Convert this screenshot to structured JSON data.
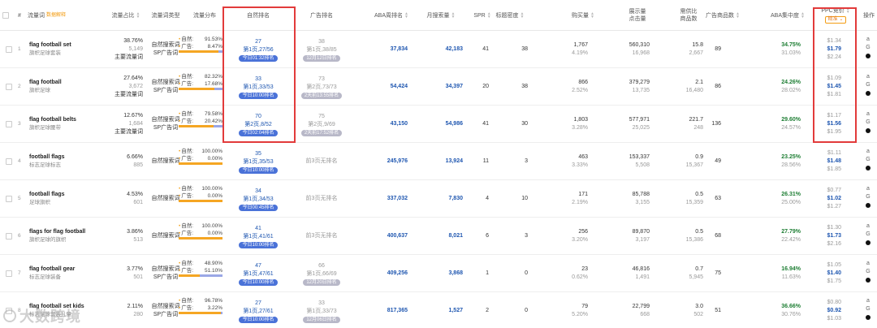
{
  "headers": {
    "idx": "#",
    "keyword": "流量词",
    "keyword_tag": "数据解释",
    "traffic_share": "流量占比",
    "traffic_type": "流量词类型",
    "traffic_dist": "流量分布",
    "organic_rank": "自然排名",
    "ad_rank": "广告排名",
    "aba_rank": "ABA周排名",
    "monthly_search": "月搜索量",
    "spr": "SPR",
    "title_density": "标题密度",
    "purchases": "购买量",
    "impressions": "展示量\n点击量",
    "supply_demand": "需供比\n商品数",
    "ad_products": "广告商品数",
    "aba_concentration": "ABA集中度",
    "ppc": "PPC竞价",
    "ppc_filter": "精准",
    "ops": "操作"
  },
  "rows": [
    {
      "idx": "1",
      "kw": "flag football set",
      "kw_cn": "旗帜足球套装",
      "share": "38.76%",
      "share_n": "5,149",
      "share_tag": "主要流量词",
      "type1": "自然搜索词",
      "type2": "SP广告词",
      "nat_label": "自然:",
      "nat": "91.53%",
      "ad_label": "广告:",
      "ad": "8.47%",
      "nat_frac": 0.9153,
      "org_num": "27",
      "org_page": "第1页,27/56",
      "org_badge": "今日01:32排名",
      "org_grey": false,
      "ad_num": "38",
      "ad_page": "第1页,38/85",
      "ad_badge": "12月12日排名",
      "ad_none": "",
      "aba": "37,834",
      "monthly": "42,183",
      "spr": "41",
      "density": "38",
      "buy": "1,767",
      "buy_pct": "4.19%",
      "imp": "560,310",
      "clk": "16,968",
      "sd": "15.8",
      "prod": "2,667",
      "adp": "89",
      "conc": "34.75%",
      "conc2": "31.03%",
      "ppc1": "$1.34",
      "ppc2": "$1.79",
      "ppc3": "$2.24"
    },
    {
      "idx": "2",
      "kw": "flag football",
      "kw_cn": "旗帜足球",
      "share": "27.64%",
      "share_n": "3,672",
      "share_tag": "主要流量词",
      "type1": "自然搜索词",
      "type2": "SP广告词",
      "nat_label": "自然:",
      "nat": "82.32%",
      "ad_label": "广告:",
      "ad": "17.68%",
      "nat_frac": 0.8232,
      "org_num": "33",
      "org_page": "第1页,33/53",
      "org_badge": "今日10:00排名",
      "org_grey": false,
      "ad_num": "73",
      "ad_page": "第2页,73/73",
      "ad_badge": "2天前13:55排名",
      "ad_none": "",
      "aba": "54,424",
      "monthly": "34,397",
      "spr": "20",
      "density": "38",
      "buy": "866",
      "buy_pct": "2.52%",
      "imp": "379,279",
      "clk": "13,735",
      "sd": "2.1",
      "prod": "16,480",
      "adp": "86",
      "conc": "24.26%",
      "conc2": "28.02%",
      "ppc1": "$1.09",
      "ppc2": "$1.45",
      "ppc3": "$1.81"
    },
    {
      "idx": "3",
      "kw": "flag football belts",
      "kw_cn": "旗帜足球腰带",
      "share": "12.67%",
      "share_n": "1,684",
      "share_tag": "主要流量词",
      "type1": "自然搜索词",
      "type2": "SP广告词",
      "nat_label": "自然:",
      "nat": "79.58%",
      "ad_label": "广告:",
      "ad": "20.42%",
      "nat_frac": 0.7958,
      "org_num": "70",
      "org_page": "第2页,8/52",
      "org_badge": "今日02:04排名",
      "org_grey": false,
      "ad_num": "75",
      "ad_page": "第2页,9/69",
      "ad_badge": "2天前17:52排名",
      "ad_none": "",
      "aba": "43,150",
      "monthly": "54,986",
      "spr": "41",
      "density": "30",
      "buy": "1,803",
      "buy_pct": "3.28%",
      "imp": "577,971",
      "clk": "25,025",
      "sd": "221.7",
      "prod": "248",
      "adp": "136",
      "conc": "29.60%",
      "conc2": "24.57%",
      "ppc1": "$1.17",
      "ppc2": "$1.56",
      "ppc3": "$1.95"
    },
    {
      "idx": "4",
      "kw": "football flags",
      "kw_cn": "标志足球标志",
      "share": "6.66%",
      "share_n": "885",
      "share_tag": "",
      "type1": "自然搜索词",
      "type2": "",
      "nat_label": "自然:",
      "nat": "100.00%",
      "ad_label": "广告:",
      "ad": "0.00%",
      "nat_frac": 1.0,
      "org_num": "35",
      "org_page": "第1页,35/53",
      "org_badge": "今日10:00排名",
      "org_grey": false,
      "ad_num": "",
      "ad_page": "",
      "ad_badge": "",
      "ad_none": "前3页无排名",
      "aba": "245,976",
      "monthly": "13,924",
      "spr": "11",
      "density": "3",
      "buy": "463",
      "buy_pct": "3.33%",
      "imp": "153,337",
      "clk": "5,508",
      "sd": "0.9",
      "prod": "15,367",
      "adp": "49",
      "conc": "23.25%",
      "conc2": "28.56%",
      "ppc1": "$1.11",
      "ppc2": "$1.48",
      "ppc3": "$1.85"
    },
    {
      "idx": "5",
      "kw": "football flags",
      "kw_cn": "足球旗帜",
      "share": "4.53%",
      "share_n": "601",
      "share_tag": "",
      "type1": "自然搜索词",
      "type2": "",
      "nat_label": "自然:",
      "nat": "100.00%",
      "ad_label": "广告:",
      "ad": "0.00%",
      "nat_frac": 1.0,
      "org_num": "34",
      "org_page": "第1页,34/53",
      "org_badge": "今日00:45排名",
      "org_grey": false,
      "ad_num": "",
      "ad_page": "",
      "ad_badge": "",
      "ad_none": "前3页无排名",
      "aba": "337,032",
      "monthly": "7,830",
      "spr": "4",
      "density": "10",
      "buy": "171",
      "buy_pct": "2.19%",
      "imp": "85,788",
      "clk": "3,155",
      "sd": "0.5",
      "prod": "15,359",
      "adp": "63",
      "conc": "26.31%",
      "conc2": "25.00%",
      "ppc1": "$0.77",
      "ppc2": "$1.02",
      "ppc3": "$1.27"
    },
    {
      "idx": "6",
      "kw": "flags for flag football",
      "kw_cn": "旗帜足球的旗帜",
      "share": "3.86%",
      "share_n": "513",
      "share_tag": "",
      "type1": "自然搜索词",
      "type2": "",
      "nat_label": "自然:",
      "nat": "100.00%",
      "ad_label": "广告:",
      "ad": "0.00%",
      "nat_frac": 1.0,
      "org_num": "41",
      "org_page": "第1页,41/61",
      "org_badge": "今日10:00排名",
      "org_grey": false,
      "ad_num": "",
      "ad_page": "",
      "ad_badge": "",
      "ad_none": "前3页无排名",
      "aba": "400,637",
      "monthly": "8,021",
      "spr": "6",
      "density": "3",
      "buy": "256",
      "buy_pct": "3.20%",
      "imp": "89,870",
      "clk": "3,197",
      "sd": "0.5",
      "prod": "15,386",
      "adp": "68",
      "conc": "27.79%",
      "conc2": "22.42%",
      "ppc1": "$1.30",
      "ppc2": "$1.73",
      "ppc3": "$2.16"
    },
    {
      "idx": "7",
      "kw": "flag football gear",
      "kw_cn": "标志足球装备",
      "share": "3.77%",
      "share_n": "501",
      "share_tag": "",
      "type1": "自然搜索词",
      "type2": "SP广告词",
      "nat_label": "自然:",
      "nat": "48.90%",
      "ad_label": "广告:",
      "ad": "51.10%",
      "nat_frac": 0.489,
      "org_num": "47",
      "org_page": "第1页,47/61",
      "org_badge": "今日10:00排名",
      "org_grey": false,
      "ad_num": "66",
      "ad_page": "第1页,66/69",
      "ad_badge": "12月20日排名",
      "ad_none": "",
      "aba": "409,256",
      "monthly": "3,868",
      "spr": "1",
      "density": "0",
      "buy": "23",
      "buy_pct": "0.62%",
      "imp": "46,816",
      "clk": "1,491",
      "sd": "0.7",
      "prod": "5,945",
      "adp": "75",
      "conc": "16.94%",
      "conc2": "11.63%",
      "ppc1": "$1.05",
      "ppc2": "$1.40",
      "ppc3": "$1.75"
    },
    {
      "idx": "8",
      "kw": "flag football set kids",
      "kw_cn": "标志足球套装儿童",
      "share": "2.11%",
      "share_n": "280",
      "share_tag": "",
      "type1": "自然搜索词",
      "type2": "SP广告词",
      "nat_label": "自然:",
      "nat": "96.78%",
      "ad_label": "广告:",
      "ad": "3.22%",
      "nat_frac": 0.9678,
      "org_num": "27",
      "org_page": "第1页,27/61",
      "org_badge": "今日10:00排名",
      "org_grey": false,
      "ad_num": "33",
      "ad_page": "第1页,33/73",
      "ad_badge": "12月06日排名",
      "ad_none": "",
      "aba": "817,365",
      "monthly": "1,527",
      "spr": "2",
      "density": "0",
      "buy": "79",
      "buy_pct": "5.20%",
      "imp": "22,799",
      "clk": "668",
      "sd": "3.0",
      "prod": "502",
      "adp": "51",
      "conc": "36.66%",
      "conc2": "30.76%",
      "ppc1": "$0.80",
      "ppc2": "$0.92",
      "ppc3": "$1.03"
    }
  ],
  "ops_icons": [
    "amazon-icon",
    "google-icon",
    "dot-icon"
  ],
  "ops_glyphs": {
    "a": "a",
    "g": "G"
  },
  "watermark": "大数跨境"
}
